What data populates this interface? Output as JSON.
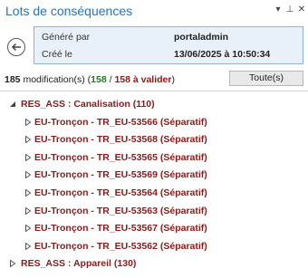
{
  "pane": {
    "title": "Lots de conséquences",
    "dropdown_glyph": "▾",
    "pin_glyph": "⊥",
    "close_glyph": "✕"
  },
  "info": {
    "generated_by_label": "Généré par",
    "generated_by_value": "portaladmin",
    "created_label": "Créé le",
    "created_value": "13/06/2025 à 10:50:34"
  },
  "summary": {
    "count": "185",
    "text": " modification(s) (",
    "validated": "158",
    "slash": " / ",
    "to_validate": "158 à valider",
    "close": ")"
  },
  "toolbar": {
    "all_button": "Toute(s)"
  },
  "tree": {
    "group1": {
      "label": "RES_ASS : Canalisation (110)",
      "expanded": true,
      "children": [
        "EU-Tronçon - TR_EU-53566 (Séparatif)",
        "EU-Tronçon - TR_EU-53568 (Séparatif)",
        "EU-Tronçon - TR_EU-53565 (Séparatif)",
        "EU-Tronçon - TR_EU-53569 (Séparatif)",
        "EU-Tronçon - TR_EU-53564 (Séparatif)",
        "EU-Tronçon - TR_EU-53563 (Séparatif)",
        "EU-Tronçon - TR_EU-53567 (Séparatif)",
        "EU-Tronçon - TR_EU-53562 (Séparatif)"
      ]
    },
    "group2": {
      "label": "RES_ASS : Appareil (130)",
      "expanded": false
    }
  },
  "colors": {
    "title": "#2a73b8",
    "item_text": "#8b1a1a",
    "validated": "#1f7a1f",
    "info_bg": "#e8f1fa",
    "info_border": "#8fb4db"
  }
}
